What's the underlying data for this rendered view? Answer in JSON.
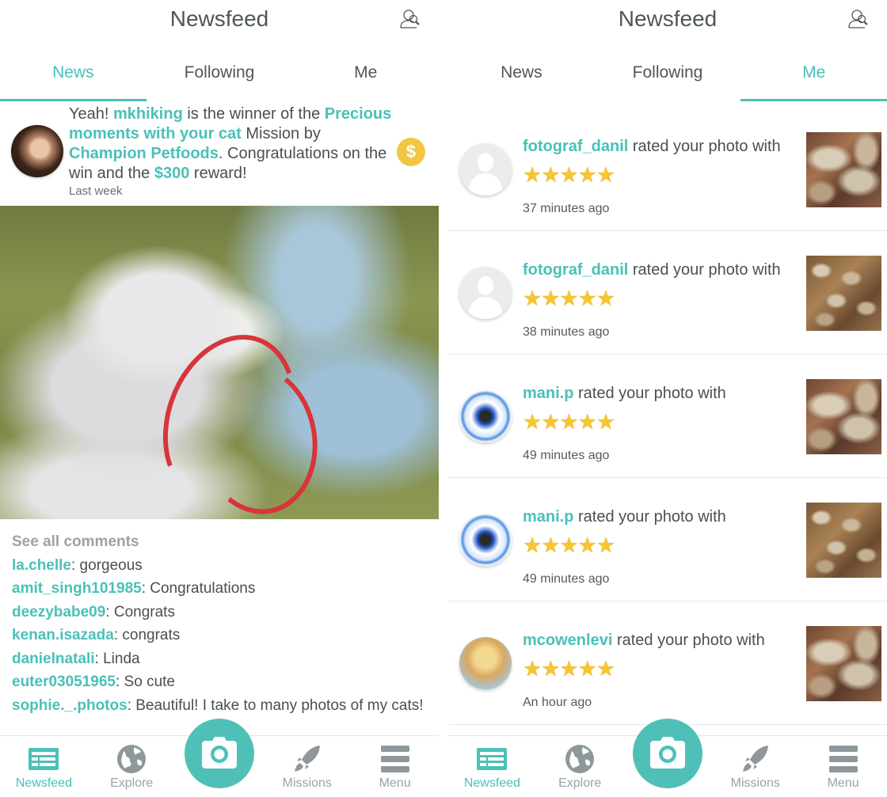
{
  "colors": {
    "accent": "#49c1b8",
    "text": "#4a4f52",
    "muted": "#9aa3a6",
    "coin": "#f1c644",
    "star": "#f6c531"
  },
  "left": {
    "header": {
      "title": "Newsfeed",
      "search_icon": "search-user-icon"
    },
    "tabs": [
      {
        "label": "News",
        "active": true
      },
      {
        "label": "Following",
        "active": false
      },
      {
        "label": "Me",
        "active": false
      }
    ],
    "news": {
      "prefix": "Yeah! ",
      "user": "mkhiking",
      "mid1": " is the winner of the ",
      "mission": "Precious moments with your cat",
      "mid2": " Mission by ",
      "brand": "Champion Petfoods",
      "mid3": ". Congratulations on the win and the ",
      "reward": "$300",
      "suffix": " reward!",
      "time": "Last week",
      "badge_icon": "dollar-coin-icon",
      "badge_text": "$"
    },
    "comments": {
      "see_all": "See all comments",
      "items": [
        {
          "user": "la.chelle",
          "text": ": gorgeous"
        },
        {
          "user": "amit_singh101985",
          "text": ": Congratulations"
        },
        {
          "user": "deezybabe09",
          "text": ": Congrats"
        },
        {
          "user": "kenan.isazada",
          "text": ": congrats"
        },
        {
          "user": "danielnatali",
          "text": ": Linda"
        },
        {
          "user": "euter03051965",
          "text": ": So cute"
        },
        {
          "user": "sophie._.photos",
          "text": ": Beautiful! I take to many photos of my cats!"
        }
      ]
    },
    "nav": [
      {
        "label": "Newsfeed",
        "icon": "newsfeed-icon",
        "active": true
      },
      {
        "label": "Explore",
        "icon": "globe-icon",
        "active": false
      },
      {
        "label": "",
        "icon": "camera-icon",
        "active": false
      },
      {
        "label": "Missions",
        "icon": "rocket-icon",
        "active": false
      },
      {
        "label": "Menu",
        "icon": "menu-icon",
        "active": false
      }
    ]
  },
  "right": {
    "header": {
      "title": "Newsfeed",
      "search_icon": "search-user-icon"
    },
    "tabs": [
      {
        "label": "News",
        "active": false
      },
      {
        "label": "Following",
        "active": false
      },
      {
        "label": "Me",
        "active": true
      }
    ],
    "notifications": [
      {
        "user": "fotograf_danil",
        "action": " rated your photo with",
        "rating": 5,
        "stars": "★★★★★",
        "time": "37 minutes ago"
      },
      {
        "user": "fotograf_danil",
        "action": " rated your photo with",
        "rating": 5,
        "stars": "★★★★★",
        "time": "38 minutes ago"
      },
      {
        "user": "mani.p",
        "action": " rated your photo with",
        "rating": 5,
        "stars": "★★★★★",
        "time": "49 minutes ago"
      },
      {
        "user": "mani.p",
        "action": " rated your photo with",
        "rating": 5,
        "stars": "★★★★★",
        "time": "49 minutes ago"
      },
      {
        "user": "mcowenlevi",
        "action": " rated your photo with",
        "rating": 5,
        "stars": "★★★★★",
        "time": "An hour ago"
      }
    ],
    "nav": [
      {
        "label": "Newsfeed",
        "icon": "newsfeed-icon",
        "active": true
      },
      {
        "label": "Explore",
        "icon": "globe-icon",
        "active": false
      },
      {
        "label": "",
        "icon": "camera-icon",
        "active": false
      },
      {
        "label": "Missions",
        "icon": "rocket-icon",
        "active": false
      },
      {
        "label": "Menu",
        "icon": "menu-icon",
        "active": false
      }
    ]
  }
}
